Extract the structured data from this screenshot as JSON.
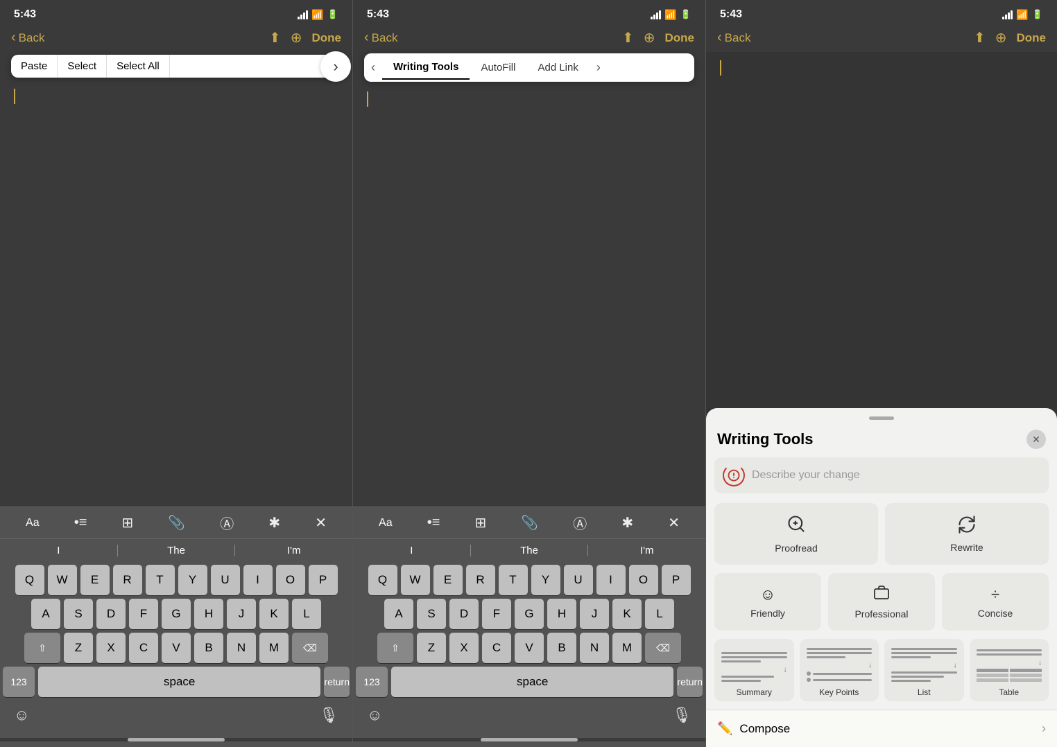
{
  "panel1": {
    "status": {
      "time": "5:43"
    },
    "nav": {
      "back": "Back",
      "done": "Done"
    },
    "context_menu": {
      "items": [
        "Paste",
        "Select",
        "Select All"
      ],
      "arrow": "›"
    },
    "keyboard_toolbar": {
      "icons": [
        "Aa",
        "•≡",
        "⊞",
        "⌀",
        "Ⓐ",
        "✱",
        "✕"
      ]
    },
    "word_suggestions": [
      "I",
      "The",
      "I'm"
    ],
    "rows": {
      "row1": [
        "Q",
        "W",
        "E",
        "R",
        "T",
        "Y",
        "U",
        "I",
        "O",
        "P"
      ],
      "row2": [
        "A",
        "S",
        "D",
        "F",
        "G",
        "H",
        "J",
        "K",
        "L"
      ],
      "row3": [
        "Z",
        "X",
        "C",
        "V",
        "B",
        "N",
        "M"
      ],
      "bottom": {
        "num": "123",
        "space": "space",
        "return": "return"
      }
    }
  },
  "panel2": {
    "status": {
      "time": "5:43"
    },
    "nav": {
      "back": "Back",
      "done": "Done"
    },
    "context_menu": {
      "active": "Writing Tools",
      "items": [
        "AutoFill",
        "Add Link"
      ]
    },
    "keyboard_toolbar": {
      "icons": [
        "Aa",
        "•≡",
        "⊞",
        "⌀",
        "Ⓐ",
        "✱",
        "✕"
      ]
    },
    "word_suggestions": [
      "I",
      "The",
      "I'm"
    ],
    "rows": {
      "row1": [
        "Q",
        "W",
        "E",
        "R",
        "T",
        "Y",
        "U",
        "I",
        "O",
        "P"
      ],
      "row2": [
        "A",
        "S",
        "D",
        "F",
        "G",
        "H",
        "J",
        "K",
        "L"
      ],
      "row3": [
        "Z",
        "X",
        "C",
        "V",
        "B",
        "N",
        "M"
      ],
      "bottom": {
        "num": "123",
        "space": "space",
        "return": "return"
      }
    }
  },
  "panel3": {
    "status": {
      "time": "5:43"
    },
    "nav": {
      "back": "Back",
      "done": "Done"
    },
    "writing_tools_sheet": {
      "title": "Writing Tools",
      "close": "✕",
      "describe_placeholder": "Describe your change",
      "tools": [
        {
          "icon": "🔍",
          "label": "Proofread"
        },
        {
          "icon": "↻",
          "label": "Rewrite"
        }
      ],
      "tones": [
        {
          "icon": "☺",
          "label": "Friendly"
        },
        {
          "icon": "💼",
          "label": "Professional"
        },
        {
          "icon": "÷",
          "label": "Concise"
        }
      ],
      "summaries": [
        {
          "label": "Summary"
        },
        {
          "label": "Key Points"
        },
        {
          "label": "List"
        },
        {
          "label": "Table"
        }
      ],
      "compose": {
        "icon": "✏",
        "label": "Compose",
        "chevron": "›"
      }
    }
  }
}
